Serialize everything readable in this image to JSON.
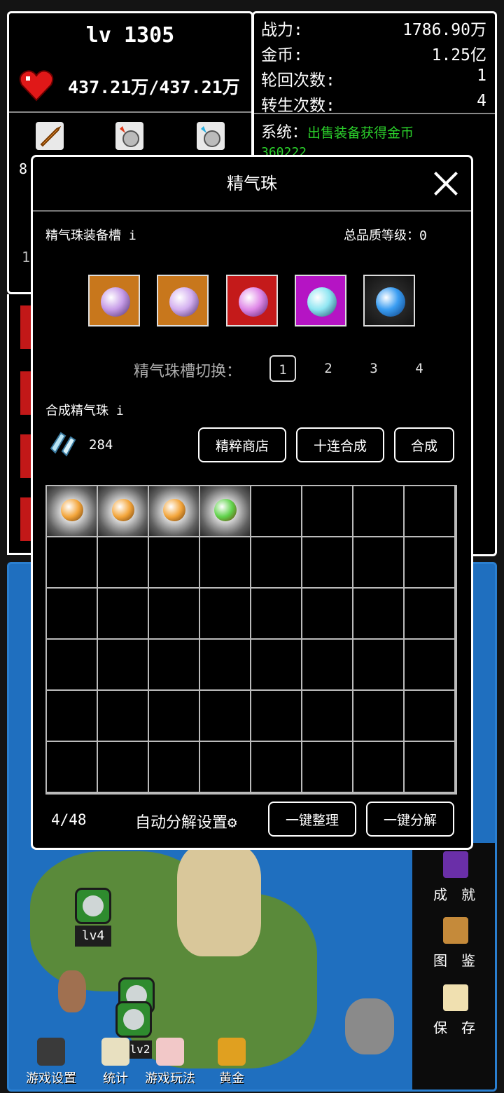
{
  "player": {
    "level": "lv 1305",
    "hp": "437.21万/437.21万",
    "partial_left_1": "8",
    "partial_left_2": "1"
  },
  "stats": [
    {
      "label": "战力:",
      "value": "1786.90万"
    },
    {
      "label": "金币:",
      "value": "1.25亿"
    },
    {
      "label": "轮回次数:",
      "value": "1"
    },
    {
      "label": "转生次数:",
      "value": "4"
    }
  ],
  "system": {
    "label": "系统：",
    "message": "出售装备获得金币",
    "amount": "360222"
  },
  "modal": {
    "title": "精气珠",
    "equip_slot_label": "精气珠装备槽 i",
    "total_quality_label": "总品质等级：0",
    "equipped": [
      {
        "icon": "purple-orb-icon",
        "frame": "#c8771c",
        "color": "#c79de8"
      },
      {
        "icon": "purple-orb-icon",
        "frame": "#c8771c",
        "color": "#d4b0f0"
      },
      {
        "icon": "pink-orb-icon",
        "frame": "#c41a1a",
        "color": "#e08ae8"
      },
      {
        "icon": "cyan-orb-icon",
        "frame": "#b514c4",
        "color": "#8fe6f2"
      },
      {
        "icon": "blue-orb-icon",
        "frame": "#505050",
        "color": "#3a9df2"
      }
    ],
    "slot_switch_label": "精气珠槽切换：",
    "slot_tabs": [
      "1",
      "2",
      "3",
      "4"
    ],
    "selected_tab": "1",
    "synth_label": "合成精气珠 i",
    "crystal_count": "284",
    "buttons": {
      "shop": "精粹商店",
      "ten_synth": "十连合成",
      "synth": "合成"
    },
    "inventory": [
      {
        "icon": "orange-orb-icon",
        "color": "#f3a53a"
      },
      {
        "icon": "orange-orb-icon",
        "color": "#f3a53a"
      },
      {
        "icon": "orange-orb-icon",
        "color": "#f3a53a"
      },
      {
        "icon": "green-orb-icon",
        "color": "#5fd24a"
      }
    ],
    "capacity": "4/48",
    "auto_decompose_label": "自动分解设置",
    "sort_button": "一键整理",
    "decompose_button": "一键分解"
  },
  "side_menu": [
    "成 就",
    "图 鉴",
    "保 存"
  ],
  "bottom_menu": [
    "游戏设置",
    "统计",
    "游戏玩法",
    "黄金"
  ],
  "map_markers": [
    "lv4",
    "lv2"
  ]
}
